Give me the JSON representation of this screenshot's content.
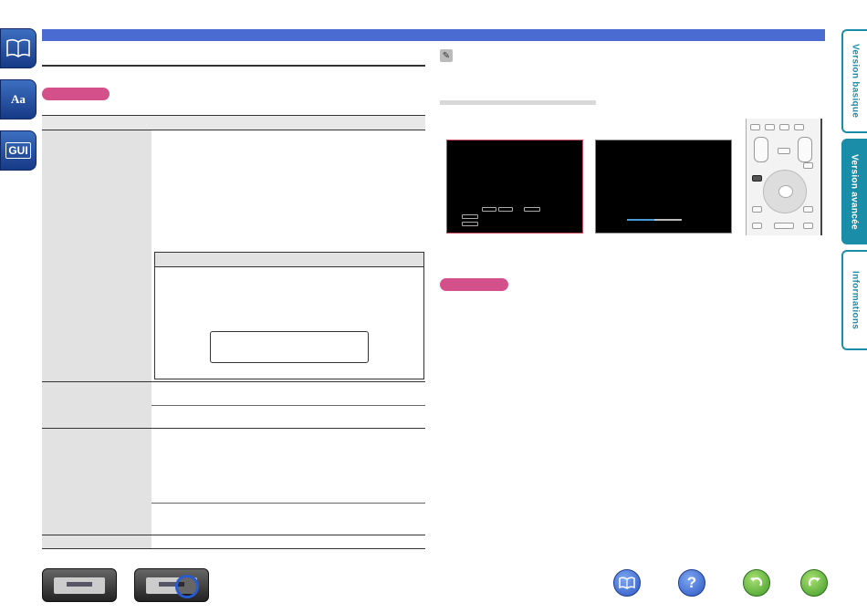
{
  "tabs": {
    "basic": "Version basique",
    "advanced": "Version avancée",
    "info": "Informations"
  },
  "side_icons": {
    "book": "book-icon",
    "glossary": "Aa",
    "gui": "GUI"
  },
  "colors": {
    "header_bar": "#4a6bd1",
    "tab_accent": "#1a8da8",
    "badge": "#d4508a",
    "table_col": "#e2e2e2"
  },
  "bottom_nav": {
    "contents_icon": "book-icon",
    "help_icon": "?",
    "back_icon": "back-arrow-icon",
    "forward_icon": "forward-arrow-icon"
  },
  "remote_icons": {
    "enter": "ENTER",
    "menu_button": "menu-button-icon"
  }
}
